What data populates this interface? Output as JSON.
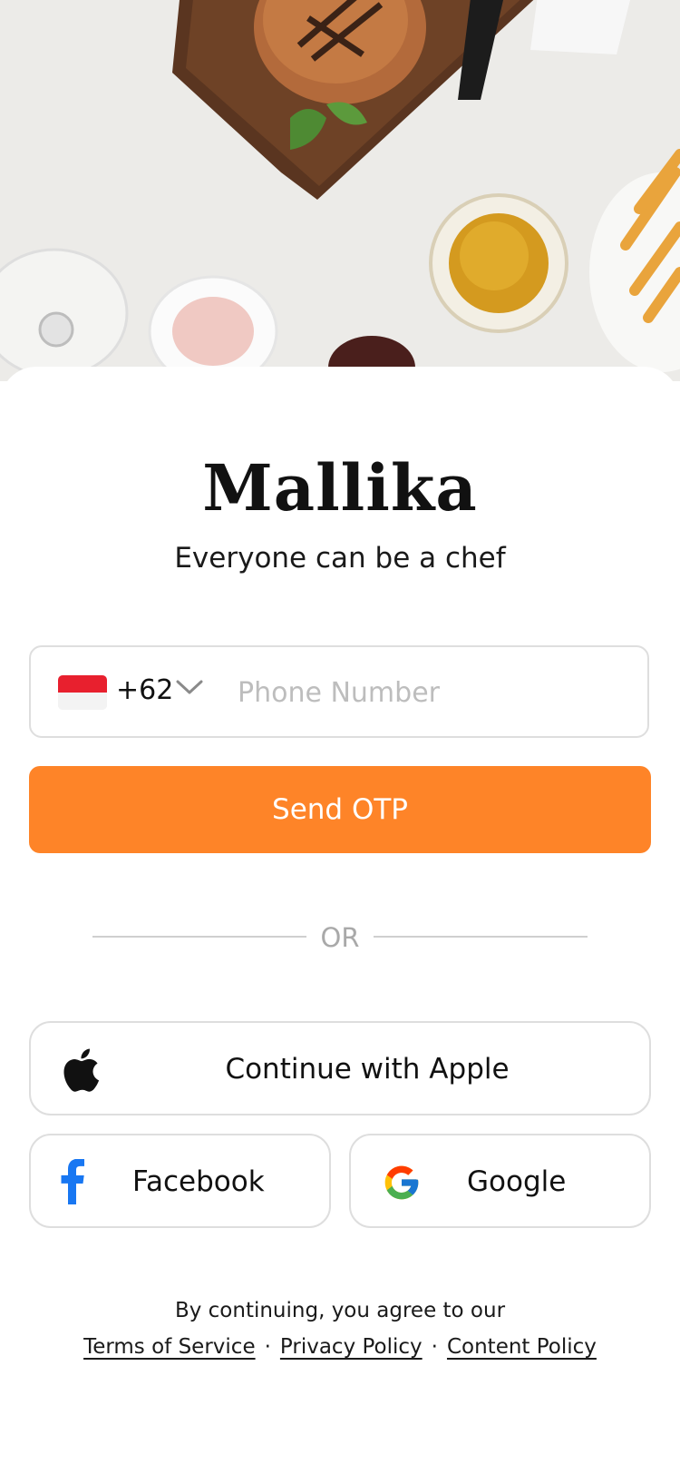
{
  "brand": {
    "name": "Mallika",
    "tagline": "Everyone can be a chef"
  },
  "phone": {
    "country_code": "+62",
    "placeholder": "Phone Number",
    "flag": "indonesia-flag"
  },
  "actions": {
    "send_otp": "Send OTP",
    "or": "OR"
  },
  "social": {
    "apple": "Continue with Apple",
    "facebook": "Facebook",
    "google": "Google"
  },
  "legal": {
    "prefix": "By continuing, you agree to our",
    "terms": "Terms of Service",
    "privacy": "Privacy Policy",
    "content": "Content Policy",
    "separator": "·"
  },
  "colors": {
    "accent": "#fe8428",
    "facebook": "#1877f2",
    "border": "#dedede"
  }
}
